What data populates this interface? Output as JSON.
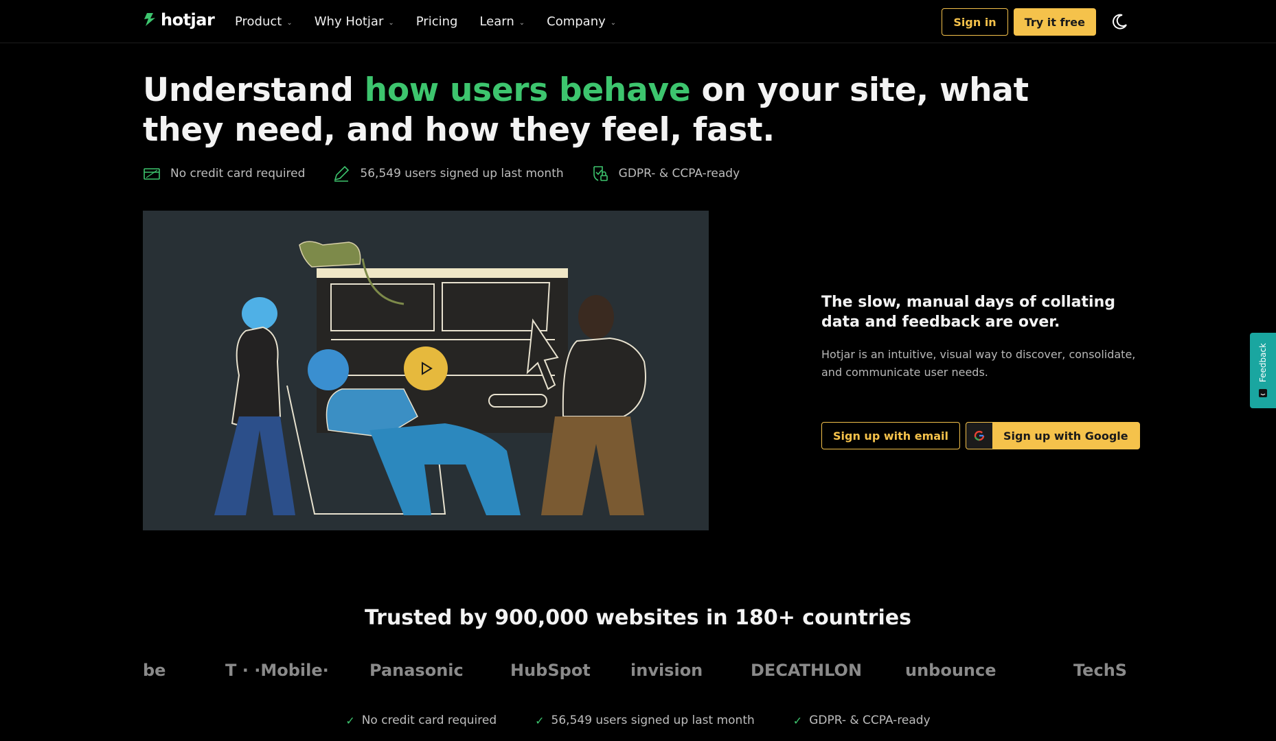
{
  "nav": {
    "brand": "hotjar",
    "items": [
      {
        "label": "Product",
        "has_dropdown": true
      },
      {
        "label": "Why Hotjar",
        "has_dropdown": true
      },
      {
        "label": "Pricing",
        "has_dropdown": false
      },
      {
        "label": "Learn",
        "has_dropdown": true
      },
      {
        "label": "Company",
        "has_dropdown": true
      }
    ],
    "sign_in": "Sign in",
    "try_free": "Try it free",
    "theme_icon": "moon-icon"
  },
  "hero": {
    "headline_before": "Understand ",
    "headline_accent": "how users behave",
    "headline_after": " on your site, what they need, and how they feel, fast.",
    "badges": [
      {
        "icon": "credit-card-icon",
        "text": "No credit card required"
      },
      {
        "icon": "pencil-icon",
        "text": "56,549 users signed up last month"
      },
      {
        "icon": "shield-lock-icon",
        "text": "GDPR- & CCPA-ready"
      }
    ]
  },
  "side": {
    "title": "The slow, manual days of collating data and feedback are over.",
    "body": "Hotjar is an intuitive, visual way to discover, consolidate, and communicate user needs.",
    "signup_email": "Sign up with email",
    "signup_google": "Sign up with Google"
  },
  "feedback_tab": "Feedback",
  "trust": {
    "title": "Trusted by 900,000 websites in 180+ countries",
    "logos": [
      "be",
      "T · ·Mobile·",
      "Panasonic",
      "HubSpot",
      "invision",
      "DECATHLON",
      "unbounce",
      "TechS"
    ]
  },
  "bottom_badges": [
    "No credit card required",
    "56,549 users signed up last month",
    "GDPR- & CCPA-ready"
  ],
  "colors": {
    "accent_green": "#3dc56e",
    "brand_yellow": "#f5c24b",
    "feedback_teal": "#1aa6a0"
  }
}
